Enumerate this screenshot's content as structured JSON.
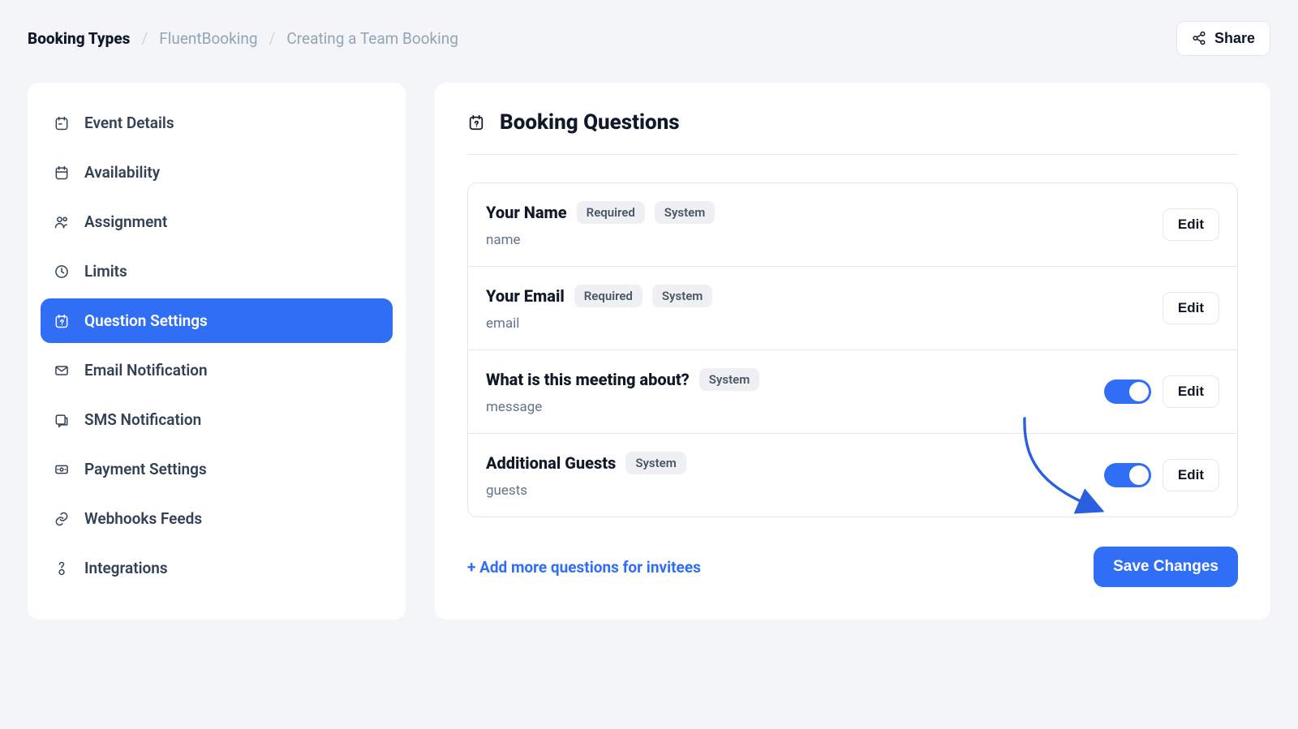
{
  "breadcrumbs": {
    "root": "Booking Types",
    "group": "FluentBooking",
    "current": "Creating a Team Booking"
  },
  "share": {
    "label": "Share"
  },
  "sidebar": {
    "items": [
      {
        "label": "Event Details"
      },
      {
        "label": "Availability"
      },
      {
        "label": "Assignment"
      },
      {
        "label": "Limits"
      },
      {
        "label": "Question Settings"
      },
      {
        "label": "Email Notification"
      },
      {
        "label": "SMS Notification"
      },
      {
        "label": "Payment Settings"
      },
      {
        "label": "Webhooks Feeds"
      },
      {
        "label": "Integrations"
      }
    ],
    "active_index": 4
  },
  "section": {
    "title": "Booking Questions"
  },
  "chips": {
    "required": "Required",
    "system": "System"
  },
  "questions": [
    {
      "title": "Your Name",
      "field": "name",
      "required": true,
      "system": true,
      "has_toggle": false,
      "toggle_on": false,
      "edit_label": "Edit"
    },
    {
      "title": "Your Email",
      "field": "email",
      "required": true,
      "system": true,
      "has_toggle": false,
      "toggle_on": false,
      "edit_label": "Edit"
    },
    {
      "title": "What is this meeting about?",
      "field": "message",
      "required": false,
      "system": true,
      "has_toggle": true,
      "toggle_on": true,
      "edit_label": "Edit"
    },
    {
      "title": "Additional Guests",
      "field": "guests",
      "required": false,
      "system": true,
      "has_toggle": true,
      "toggle_on": true,
      "edit_label": "Edit"
    }
  ],
  "actions": {
    "add_more": "+ Add more questions for invitees",
    "save": "Save Changes"
  }
}
